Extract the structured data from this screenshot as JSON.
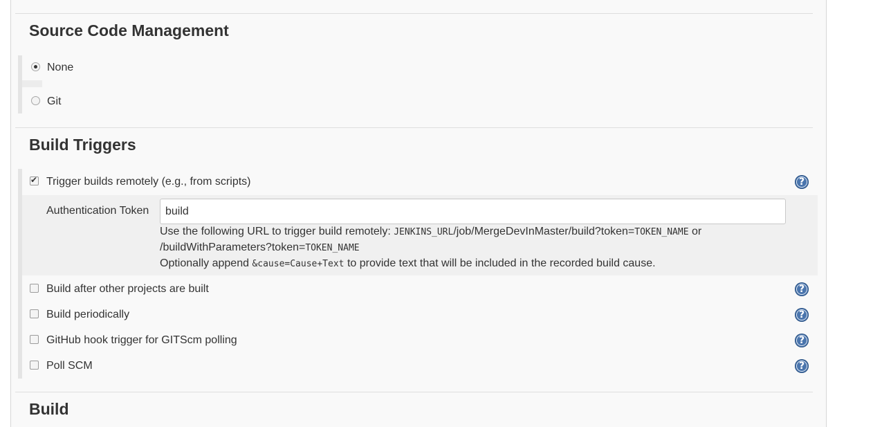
{
  "scm": {
    "title": "Source Code Management",
    "options": [
      {
        "label": "None",
        "selected": true
      },
      {
        "label": "Git",
        "selected": false
      }
    ]
  },
  "triggers": {
    "title": "Build Triggers",
    "remote": {
      "label": "Trigger builds remotely (e.g., from scripts)",
      "checked": true,
      "token_label": "Authentication Token",
      "token_value": "build",
      "desc_part1": "Use the following URL to trigger build remotely: ",
      "desc_code1": "JENKINS_URL",
      "desc_part2": "/job/MergeDevInMaster/build?token=",
      "desc_code2": "TOKEN_NAME",
      "desc_part3": " or",
      "desc_line2_part1": "/buildWithParameters?token=",
      "desc_line2_code": "TOKEN_NAME",
      "desc_line3_part1": "Optionally append ",
      "desc_line3_code": "&cause=Cause+Text",
      "desc_line3_part2": " to provide text that will be included in the recorded build cause."
    },
    "options": [
      {
        "label": "Build after other projects are built",
        "checked": false
      },
      {
        "label": "Build periodically",
        "checked": false
      },
      {
        "label": "GitHub hook trigger for GITScm polling",
        "checked": false
      },
      {
        "label": "Poll SCM",
        "checked": false
      }
    ],
    "help_icon_text": "?"
  },
  "build": {
    "title": "Build"
  },
  "colors": {
    "help_icon": "#4a75ad",
    "panel_bg": "#f9f9f9",
    "subpanel_bg": "#f0f0f0"
  }
}
